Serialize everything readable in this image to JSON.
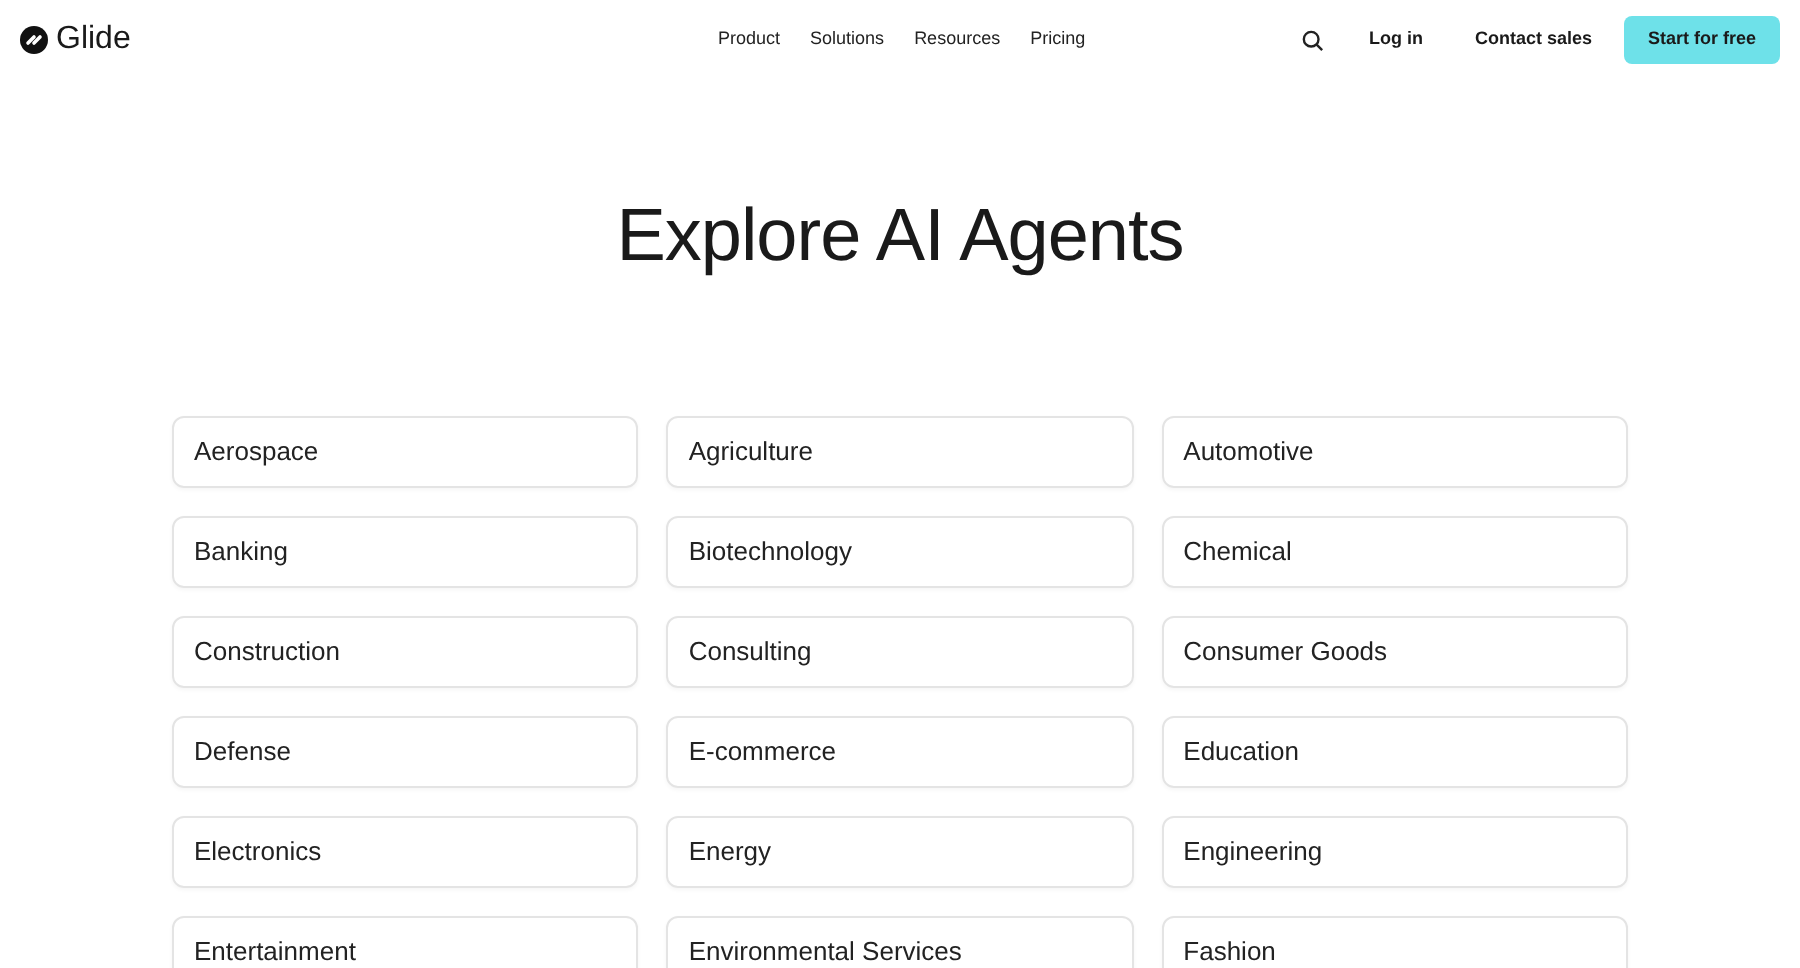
{
  "header": {
    "brand": "Glide",
    "nav": [
      "Product",
      "Solutions",
      "Resources",
      "Pricing"
    ],
    "login": "Log in",
    "contact": "Contact sales",
    "cta": "Start for free"
  },
  "title": "Explore AI Agents",
  "industries": [
    "Aerospace",
    "Agriculture",
    "Automotive",
    "Banking",
    "Biotechnology",
    "Chemical",
    "Construction",
    "Consulting",
    "Consumer Goods",
    "Defense",
    "E-commerce",
    "Education",
    "Electronics",
    "Energy",
    "Engineering",
    "Entertainment",
    "Environmental Services",
    "Fashion"
  ]
}
